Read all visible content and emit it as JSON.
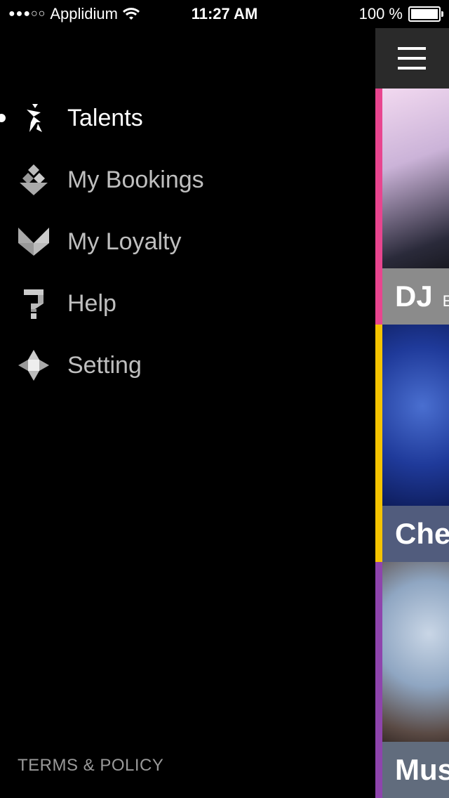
{
  "status_bar": {
    "carrier": "Applidium",
    "signal": "●●●○○",
    "time": "11:27 AM",
    "battery": "100 %"
  },
  "menu": {
    "items": [
      {
        "label": "Talents",
        "icon": "talents-icon",
        "active": true
      },
      {
        "label": "My Bookings",
        "icon": "bookings-icon",
        "active": false
      },
      {
        "label": "My Loyalty",
        "icon": "loyalty-icon",
        "active": false
      },
      {
        "label": "Help",
        "icon": "help-icon",
        "active": false
      },
      {
        "label": "Setting",
        "icon": "setting-icon",
        "active": false
      }
    ],
    "terms": "TERMS & POLICY"
  },
  "main": {
    "menu_icon": "hamburger-icon",
    "cards": [
      {
        "caption": "DJ",
        "sub": "E",
        "accent": "#e8458f"
      },
      {
        "caption": "Che",
        "sub": "",
        "accent": "#f5c400"
      },
      {
        "caption": "Mus",
        "sub": "",
        "accent": "#8e44ad"
      }
    ]
  }
}
